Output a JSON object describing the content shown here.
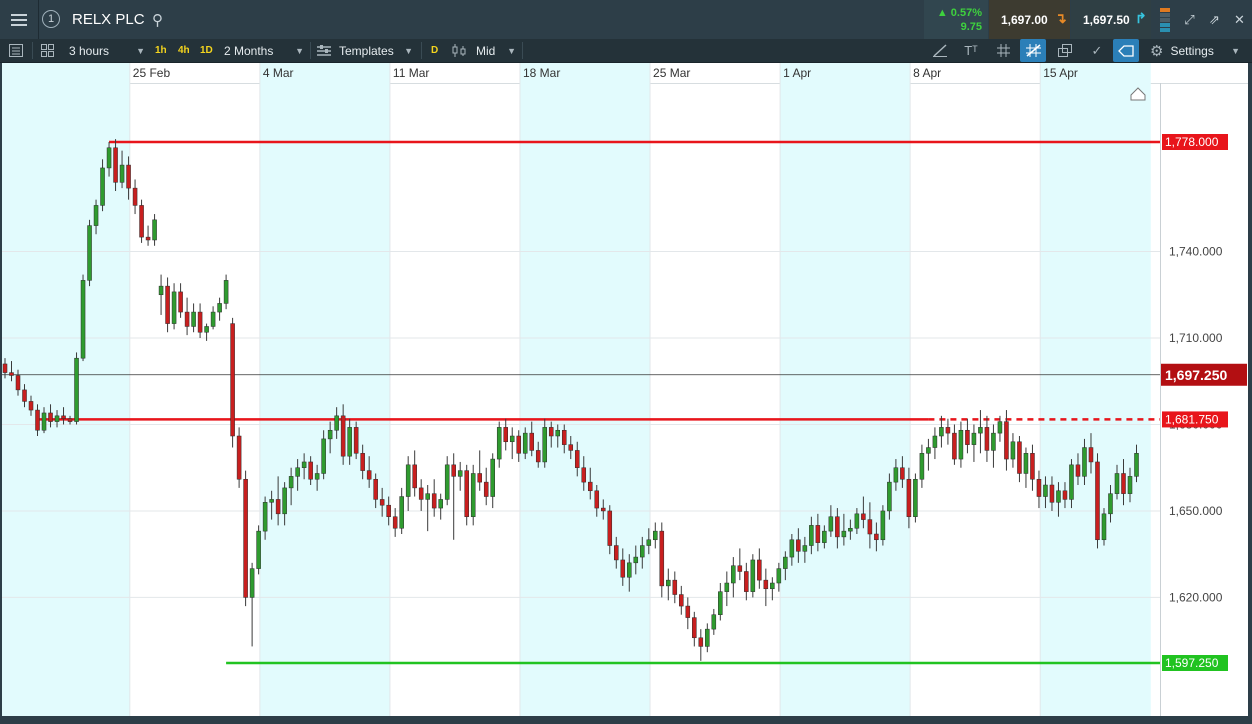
{
  "header": {
    "symbol": "RELX PLC",
    "change_pct": "▲ 0.57%",
    "change_abs": "9.75",
    "sell_price": "1,697.00",
    "buy_price": "1,697.50"
  },
  "toolbar": {
    "interval": "3 hours",
    "quick_1h": "1h",
    "quick_4h": "4h",
    "quick_1d": "1D",
    "range": "2 Months",
    "templates": "Templates",
    "d_badge": "D",
    "price_type": "Mid",
    "settings": "Settings"
  },
  "colors": {
    "up": "#2f9b2f",
    "down": "#c81f1f",
    "resistance": "#e8151b",
    "support": "#21c321",
    "shade": "#e2fbfd"
  },
  "chart_data": {
    "type": "candlestick",
    "instrument": "RELX PLC",
    "interval": "3 hours",
    "range": "2 Months",
    "ylim": [
      1585,
      1795
    ],
    "y_ticks": [
      1620,
      1650,
      1680,
      1710,
      1740
    ],
    "y_tick_labels": [
      "1,620.000",
      "1,650.000",
      "1,680.000",
      "1,710.000",
      "1,740.000"
    ],
    "x_tick_labels": [
      "25 Feb",
      "4 Mar",
      "11 Mar",
      "18 Mar",
      "25 Mar",
      "1 Apr",
      "8 Apr",
      "15 Apr"
    ],
    "x_tick_index": [
      20,
      40,
      60,
      80,
      100,
      120,
      140,
      160
    ],
    "x_index_range": [
      0,
      177
    ],
    "shaded_weeks": [
      [
        0,
        20
      ],
      [
        40,
        60
      ],
      [
        80,
        100
      ],
      [
        120,
        140
      ],
      [
        160,
        177
      ]
    ],
    "current_price": {
      "value": 1697.25,
      "label": "1,697.250"
    },
    "horizontal_lines": [
      {
        "name": "resistance-high",
        "value": 1778.0,
        "label": "1,778.000",
        "color": "#e8151b",
        "from_index": 16,
        "to_index": 177,
        "style": "solid"
      },
      {
        "name": "resistance-mid",
        "value": 1681.75,
        "label": "1,681.750",
        "color": "#e8151b",
        "from_index": 5,
        "to_index": 177,
        "style": "solid-then-dashed",
        "dash_from_index": 142
      },
      {
        "name": "support-low",
        "value": 1597.25,
        "label": "1,597.250",
        "color": "#21c321",
        "from_index": 34,
        "to_index": 177,
        "style": "solid"
      }
    ],
    "candles": [
      [
        1701,
        1703,
        1696,
        1698
      ],
      [
        1698,
        1702,
        1695,
        1697
      ],
      [
        1697,
        1699,
        1690,
        1692
      ],
      [
        1692,
        1694,
        1686,
        1688
      ],
      [
        1688,
        1690,
        1683,
        1685
      ],
      [
        1685,
        1687,
        1676,
        1678
      ],
      [
        1678,
        1686,
        1677,
        1684
      ],
      [
        1684,
        1687,
        1679,
        1681
      ],
      [
        1681,
        1685,
        1679,
        1683
      ],
      [
        1683,
        1686,
        1680,
        1682
      ],
      [
        1682,
        1683,
        1680,
        1681
      ],
      [
        1681,
        1705,
        1680,
        1703
      ],
      [
        1703,
        1732,
        1702,
        1730
      ],
      [
        1730,
        1751,
        1728,
        1749
      ],
      [
        1749,
        1758,
        1746,
        1756
      ],
      [
        1756,
        1772,
        1754,
        1769
      ],
      [
        1769,
        1778,
        1766,
        1776
      ],
      [
        1776,
        1779,
        1761,
        1764
      ],
      [
        1764,
        1775,
        1762,
        1770
      ],
      [
        1770,
        1773,
        1758,
        1762
      ],
      [
        1762,
        1765,
        1753,
        1756
      ],
      [
        1756,
        1758,
        1743,
        1745
      ],
      [
        1745,
        1749,
        1742,
        1744
      ],
      [
        1744,
        1753,
        1742,
        1751
      ],
      [
        1725,
        1732,
        1718,
        1728
      ],
      [
        1728,
        1731,
        1712,
        1715
      ],
      [
        1715,
        1729,
        1713,
        1726
      ],
      [
        1726,
        1729,
        1717,
        1719
      ],
      [
        1719,
        1724,
        1711,
        1714
      ],
      [
        1714,
        1722,
        1712,
        1719
      ],
      [
        1719,
        1722,
        1710,
        1712
      ],
      [
        1712,
        1715,
        1709,
        1714
      ],
      [
        1714,
        1721,
        1713,
        1719
      ],
      [
        1719,
        1724,
        1716,
        1722
      ],
      [
        1722,
        1732,
        1720,
        1730
      ],
      [
        1715,
        1717,
        1672,
        1676
      ],
      [
        1676,
        1679,
        1658,
        1661
      ],
      [
        1661,
        1664,
        1617,
        1620
      ],
      [
        1620,
        1632,
        1603,
        1630
      ],
      [
        1630,
        1645,
        1628,
        1643
      ],
      [
        1643,
        1655,
        1640,
        1653
      ],
      [
        1653,
        1657,
        1647,
        1654
      ],
      [
        1654,
        1662,
        1645,
        1649
      ],
      [
        1649,
        1660,
        1645,
        1658
      ],
      [
        1658,
        1665,
        1652,
        1662
      ],
      [
        1662,
        1668,
        1657,
        1665
      ],
      [
        1665,
        1670,
        1661,
        1667
      ],
      [
        1667,
        1669,
        1659,
        1661
      ],
      [
        1661,
        1666,
        1657,
        1663
      ],
      [
        1663,
        1678,
        1661,
        1675
      ],
      [
        1675,
        1681,
        1670,
        1678
      ],
      [
        1678,
        1686,
        1675,
        1683
      ],
      [
        1683,
        1687,
        1666,
        1669
      ],
      [
        1669,
        1682,
        1666,
        1679
      ],
      [
        1679,
        1681,
        1668,
        1670
      ],
      [
        1670,
        1673,
        1661,
        1664
      ],
      [
        1664,
        1669,
        1658,
        1661
      ],
      [
        1661,
        1663,
        1651,
        1654
      ],
      [
        1654,
        1658,
        1648,
        1652
      ],
      [
        1652,
        1655,
        1645,
        1648
      ],
      [
        1648,
        1651,
        1641,
        1644
      ],
      [
        1644,
        1658,
        1642,
        1655
      ],
      [
        1655,
        1669,
        1650,
        1666
      ],
      [
        1666,
        1671,
        1655,
        1658
      ],
      [
        1658,
        1661,
        1650,
        1654
      ],
      [
        1654,
        1659,
        1643,
        1656
      ],
      [
        1656,
        1661,
        1648,
        1651
      ],
      [
        1651,
        1656,
        1647,
        1654
      ],
      [
        1654,
        1669,
        1652,
        1666
      ],
      [
        1666,
        1670,
        1640,
        1662
      ],
      [
        1662,
        1667,
        1657,
        1664
      ],
      [
        1664,
        1666,
        1645,
        1648
      ],
      [
        1648,
        1666,
        1645,
        1663
      ],
      [
        1663,
        1671,
        1657,
        1660
      ],
      [
        1660,
        1665,
        1652,
        1655
      ],
      [
        1655,
        1670,
        1651,
        1668
      ],
      [
        1668,
        1681,
        1665,
        1679
      ],
      [
        1679,
        1682,
        1671,
        1674
      ],
      [
        1674,
        1679,
        1668,
        1676
      ],
      [
        1676,
        1678,
        1667,
        1670
      ],
      [
        1670,
        1679,
        1668,
        1677
      ],
      [
        1677,
        1681,
        1669,
        1671
      ],
      [
        1671,
        1674,
        1665,
        1667
      ],
      [
        1667,
        1682,
        1665,
        1679
      ],
      [
        1679,
        1681,
        1672,
        1676
      ],
      [
        1676,
        1680,
        1672,
        1678
      ],
      [
        1678,
        1680,
        1670,
        1673
      ],
      [
        1673,
        1676,
        1668,
        1671
      ],
      [
        1671,
        1674,
        1662,
        1665
      ],
      [
        1665,
        1669,
        1657,
        1660
      ],
      [
        1660,
        1665,
        1654,
        1657
      ],
      [
        1657,
        1659,
        1648,
        1651
      ],
      [
        1651,
        1654,
        1647,
        1650
      ],
      [
        1650,
        1652,
        1635,
        1638
      ],
      [
        1638,
        1641,
        1630,
        1633
      ],
      [
        1633,
        1637,
        1624,
        1627
      ],
      [
        1627,
        1635,
        1622,
        1632
      ],
      [
        1632,
        1638,
        1628,
        1634
      ],
      [
        1634,
        1641,
        1630,
        1638
      ],
      [
        1638,
        1644,
        1635,
        1640
      ],
      [
        1640,
        1646,
        1637,
        1643
      ],
      [
        1643,
        1646,
        1620,
        1624
      ],
      [
        1624,
        1630,
        1619,
        1626
      ],
      [
        1626,
        1629,
        1618,
        1621
      ],
      [
        1621,
        1624,
        1614,
        1617
      ],
      [
        1617,
        1620,
        1609,
        1613
      ],
      [
        1613,
        1615,
        1603,
        1606
      ],
      [
        1606,
        1609,
        1598,
        1603
      ],
      [
        1603,
        1611,
        1601,
        1609
      ],
      [
        1609,
        1616,
        1607,
        1614
      ],
      [
        1614,
        1625,
        1612,
        1622
      ],
      [
        1622,
        1629,
        1617,
        1625
      ],
      [
        1625,
        1634,
        1620,
        1631
      ],
      [
        1631,
        1637,
        1626,
        1629
      ],
      [
        1629,
        1632,
        1619,
        1622
      ],
      [
        1622,
        1635,
        1620,
        1633
      ],
      [
        1633,
        1637,
        1623,
        1626
      ],
      [
        1626,
        1630,
        1617,
        1623
      ],
      [
        1623,
        1627,
        1619,
        1625
      ],
      [
        1625,
        1632,
        1622,
        1630
      ],
      [
        1630,
        1636,
        1626,
        1634
      ],
      [
        1634,
        1642,
        1631,
        1640
      ],
      [
        1640,
        1644,
        1632,
        1636
      ],
      [
        1636,
        1641,
        1632,
        1638
      ],
      [
        1638,
        1648,
        1635,
        1645
      ],
      [
        1645,
        1649,
        1636,
        1639
      ],
      [
        1639,
        1645,
        1637,
        1643
      ],
      [
        1643,
        1652,
        1641,
        1648
      ],
      [
        1648,
        1651,
        1637,
        1641
      ],
      [
        1641,
        1649,
        1638,
        1643
      ],
      [
        1643,
        1647,
        1640,
        1644
      ],
      [
        1644,
        1651,
        1642,
        1649
      ],
      [
        1649,
        1655,
        1644,
        1647
      ],
      [
        1647,
        1653,
        1637,
        1642
      ],
      [
        1642,
        1646,
        1636,
        1640
      ],
      [
        1640,
        1652,
        1638,
        1650
      ],
      [
        1650,
        1663,
        1647,
        1660
      ],
      [
        1660,
        1668,
        1657,
        1665
      ],
      [
        1665,
        1669,
        1658,
        1661
      ],
      [
        1661,
        1665,
        1644,
        1648
      ],
      [
        1648,
        1663,
        1646,
        1661
      ],
      [
        1661,
        1673,
        1658,
        1670
      ],
      [
        1670,
        1675,
        1664,
        1672
      ],
      [
        1672,
        1679,
        1668,
        1676
      ],
      [
        1676,
        1683,
        1672,
        1679
      ],
      [
        1679,
        1682,
        1673,
        1677
      ],
      [
        1677,
        1680,
        1666,
        1668
      ],
      [
        1668,
        1681,
        1665,
        1678
      ],
      [
        1678,
        1682,
        1670,
        1673
      ],
      [
        1673,
        1680,
        1667,
        1677
      ],
      [
        1677,
        1685,
        1670,
        1679
      ],
      [
        1679,
        1683,
        1667,
        1671
      ],
      [
        1671,
        1680,
        1665,
        1677
      ],
      [
        1677,
        1683,
        1674,
        1681
      ],
      [
        1681,
        1685,
        1664,
        1668
      ],
      [
        1668,
        1677,
        1665,
        1674
      ],
      [
        1674,
        1676,
        1660,
        1663
      ],
      [
        1663,
        1672,
        1658,
        1670
      ],
      [
        1670,
        1673,
        1657,
        1661
      ],
      [
        1661,
        1664,
        1651,
        1655
      ],
      [
        1655,
        1662,
        1651,
        1659
      ],
      [
        1659,
        1662,
        1650,
        1653
      ],
      [
        1653,
        1660,
        1648,
        1657
      ],
      [
        1657,
        1660,
        1651,
        1654
      ],
      [
        1654,
        1668,
        1651,
        1666
      ],
      [
        1666,
        1670,
        1659,
        1662
      ],
      [
        1662,
        1675,
        1659,
        1672
      ],
      [
        1672,
        1677,
        1663,
        1667
      ],
      [
        1667,
        1670,
        1637,
        1640
      ],
      [
        1640,
        1651,
        1638,
        1649
      ],
      [
        1649,
        1659,
        1646,
        1656
      ],
      [
        1656,
        1666,
        1654,
        1663
      ],
      [
        1663,
        1668,
        1652,
        1656
      ],
      [
        1656,
        1665,
        1653,
        1662
      ],
      [
        1662,
        1673,
        1660,
        1670
      ]
    ]
  }
}
